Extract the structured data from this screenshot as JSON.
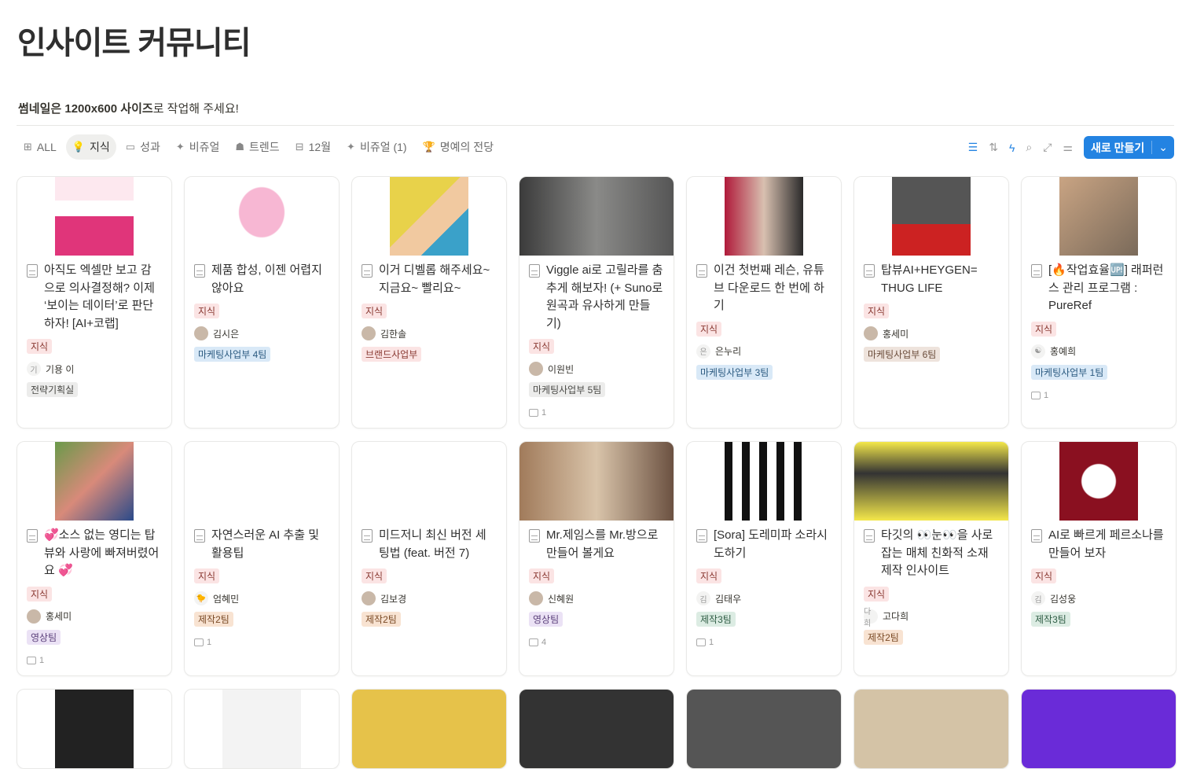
{
  "page": {
    "title": "인사이트 커뮤니티",
    "description_bold1": "썸네일은 1200x600 사이즈",
    "description_rest": "로 작업해 주세요!"
  },
  "tabs": [
    {
      "icon": "grid-icon",
      "glyph": "⊞",
      "label": "ALL"
    },
    {
      "icon": "lightbulb-icon",
      "glyph": "💡",
      "label": "지식",
      "active": true
    },
    {
      "icon": "id-card-icon",
      "glyph": "▭",
      "label": "성과"
    },
    {
      "icon": "sparkles-icon",
      "glyph": "✦",
      "label": "비쥬얼"
    },
    {
      "icon": "detective-icon",
      "glyph": "☗",
      "label": "트렌드"
    },
    {
      "icon": "table-icon",
      "glyph": "⊟",
      "label": "12월"
    },
    {
      "icon": "sparkles-icon",
      "glyph": "✦",
      "label": "비쥬얼 (1)"
    },
    {
      "icon": "trophy-icon",
      "glyph": "🏆",
      "label": "명예의 전당"
    }
  ],
  "toolbar": {
    "new_label": "새로 만들기"
  },
  "tag_colors": {
    "red": [
      "#fbe4e4",
      "#8a3a33"
    ],
    "blue": [
      "#d9e9f7",
      "#2b5a80"
    ],
    "gray": [
      "#ececeb",
      "#4a4a47"
    ],
    "brown": [
      "#eee3dc",
      "#6a4c3a"
    ],
    "purple": [
      "#ebe2f5",
      "#5a3f7a"
    ],
    "orange": [
      "#f8e3d2",
      "#7a4a25"
    ],
    "green": [
      "#dcece3",
      "#2f5d45"
    ]
  },
  "cards": [
    {
      "title": "아직도 엑셀만 보고 감으로 의사결정해? 이제 ‘보이는 데이터’로 판단하자! [AI+코랩]",
      "tag": "지식",
      "author": "기용 이",
      "avatar": "기",
      "team": "전략기획실",
      "team_color": "gray",
      "cover": "linear-gradient(180deg,#fde8ef 0 30%,#fff 30% 50%,#e0357a 50% 100%)"
    },
    {
      "title": "제품 합성, 이젠 어렵지 않아요",
      "tag": "지식",
      "author": "김시은",
      "avatar": "",
      "team": "마케팅사업부 4팀",
      "team_color": "blue",
      "cover": "radial-gradient(ellipse at 50% 45%,#f7b7d3 0 40%,#fff 42%)"
    },
    {
      "title": "이거 디벨롭 해주세요~ 지금요~ 빨리요~",
      "tag": "지식",
      "author": "김한솔",
      "avatar": "",
      "team": "브랜드사업부",
      "team_color": "red",
      "cover": "linear-gradient(135deg,#e8d24a 0 45%,#f1c9a0 45% 70%,#3aa1c9 70%)",
      "wide": false
    },
    {
      "title": "Viggle ai로 고릴라를 춤추게 해보자! (+ Suno로 원곡과 유사하게 만들기)",
      "tag": "지식",
      "author": "이원빈",
      "avatar": "",
      "team": "마케팅사업부 5팀",
      "team_color": "gray",
      "comments": "1",
      "cover": "linear-gradient(90deg,#3a3a3a,#8a8a88 50%,#555 100%)",
      "wide": true
    },
    {
      "title": "이건 첫번째 레슨, 유튜브 다운로드 한 번에 하기",
      "tag": "지식",
      "author": "은누리",
      "avatar": "은",
      "team": "마케팅사업부 3팀",
      "team_color": "blue",
      "cover": "linear-gradient(90deg,#b01a3a,#d8c0b0 50%,#2a2a2a)"
    },
    {
      "title": "탑뷰AI+HEYGEN= THUG LIFE",
      "tag": "지식",
      "author": "홍세미",
      "avatar": "",
      "team": "마케팅사업부 6팀",
      "team_color": "brown",
      "cover": "linear-gradient(180deg,#555 0 60%,#c22 60%)"
    },
    {
      "title": "[🔥작업효율🆙] 래퍼런스 관리 프로그램 : PureRef",
      "tag": "지식",
      "author": "홍예희",
      "avatar": "☯",
      "team": "마케팅사업부 1팀",
      "team_color": "blue",
      "comments": "1",
      "cover": "linear-gradient(135deg,#c9a483,#7a6a5a)"
    },
    {
      "title": "💞소스 없는 영디는 탑뷰와 사랑에 빠져버렸어요 💞",
      "tag": "지식",
      "author": "홍세미",
      "avatar": "",
      "team": "영상팀",
      "team_color": "purple",
      "comments": "1",
      "cover": "linear-gradient(135deg,#6a9a4a,#d88a7a 50%,#2a4a8a)"
    },
    {
      "title": "자연스러운 AI 추출 및 활용팁",
      "tag": "지식",
      "author": "엄혜민",
      "avatar": "🐤",
      "team": "제작2팀",
      "team_color": "orange",
      "comments": "1",
      "cover": "#fff"
    },
    {
      "title": "미드저니 최신 버전 세팅법 (feat. 버전 7)",
      "tag": "지식",
      "author": "김보경",
      "avatar": "",
      "team": "제작2팀",
      "team_color": "orange",
      "cover": "#fff"
    },
    {
      "title": "Mr.제임스를 Mr.방으로 만들어 볼게요",
      "tag": "지식",
      "author": "신혜원",
      "avatar": "",
      "team": "영상팀",
      "team_color": "purple",
      "comments": "4",
      "cover": "linear-gradient(90deg,#a07a5a,#d9c4aa 50%,#6a5040)",
      "wide": true
    },
    {
      "title": "[Sora] 도레미파 소라시도하기",
      "tag": "지식",
      "author": "김태우",
      "avatar": "김",
      "team": "제작3팀",
      "team_color": "green",
      "comments": "1",
      "cover": "repeating-linear-gradient(90deg,#111 0 10px,#fff 10px 22px)"
    },
    {
      "title": "타깃의 👀눈👀을 사로잡는 매체 친화적 소재 제작 인사이트",
      "tag": "지식",
      "author": "고다희",
      "avatar": "다희",
      "team": "제작2팀",
      "team_color": "orange",
      "cover": "linear-gradient(180deg,#f4e84a,#333 40%,#f4e84a)",
      "wide": true
    },
    {
      "title": "AI로 빠르게 페르소나를 만들어 보자",
      "tag": "지식",
      "author": "김성웅",
      "avatar": "김",
      "team": "제작3팀",
      "team_color": "green",
      "cover": "radial-gradient(ellipse at 50% 50%,#fff 0 30%,#8a1020 32%)"
    },
    {
      "cover": "#222"
    },
    {
      "cover": "#f3f3f3"
    },
    {
      "cover": "#e6c24a",
      "wide": true
    },
    {
      "cover": "#333",
      "wide": true
    },
    {
      "cover": "#555",
      "wide": true
    },
    {
      "cover": "#d4c3a6",
      "wide": true
    },
    {
      "cover": "#6a2bd8",
      "wide": true
    }
  ]
}
